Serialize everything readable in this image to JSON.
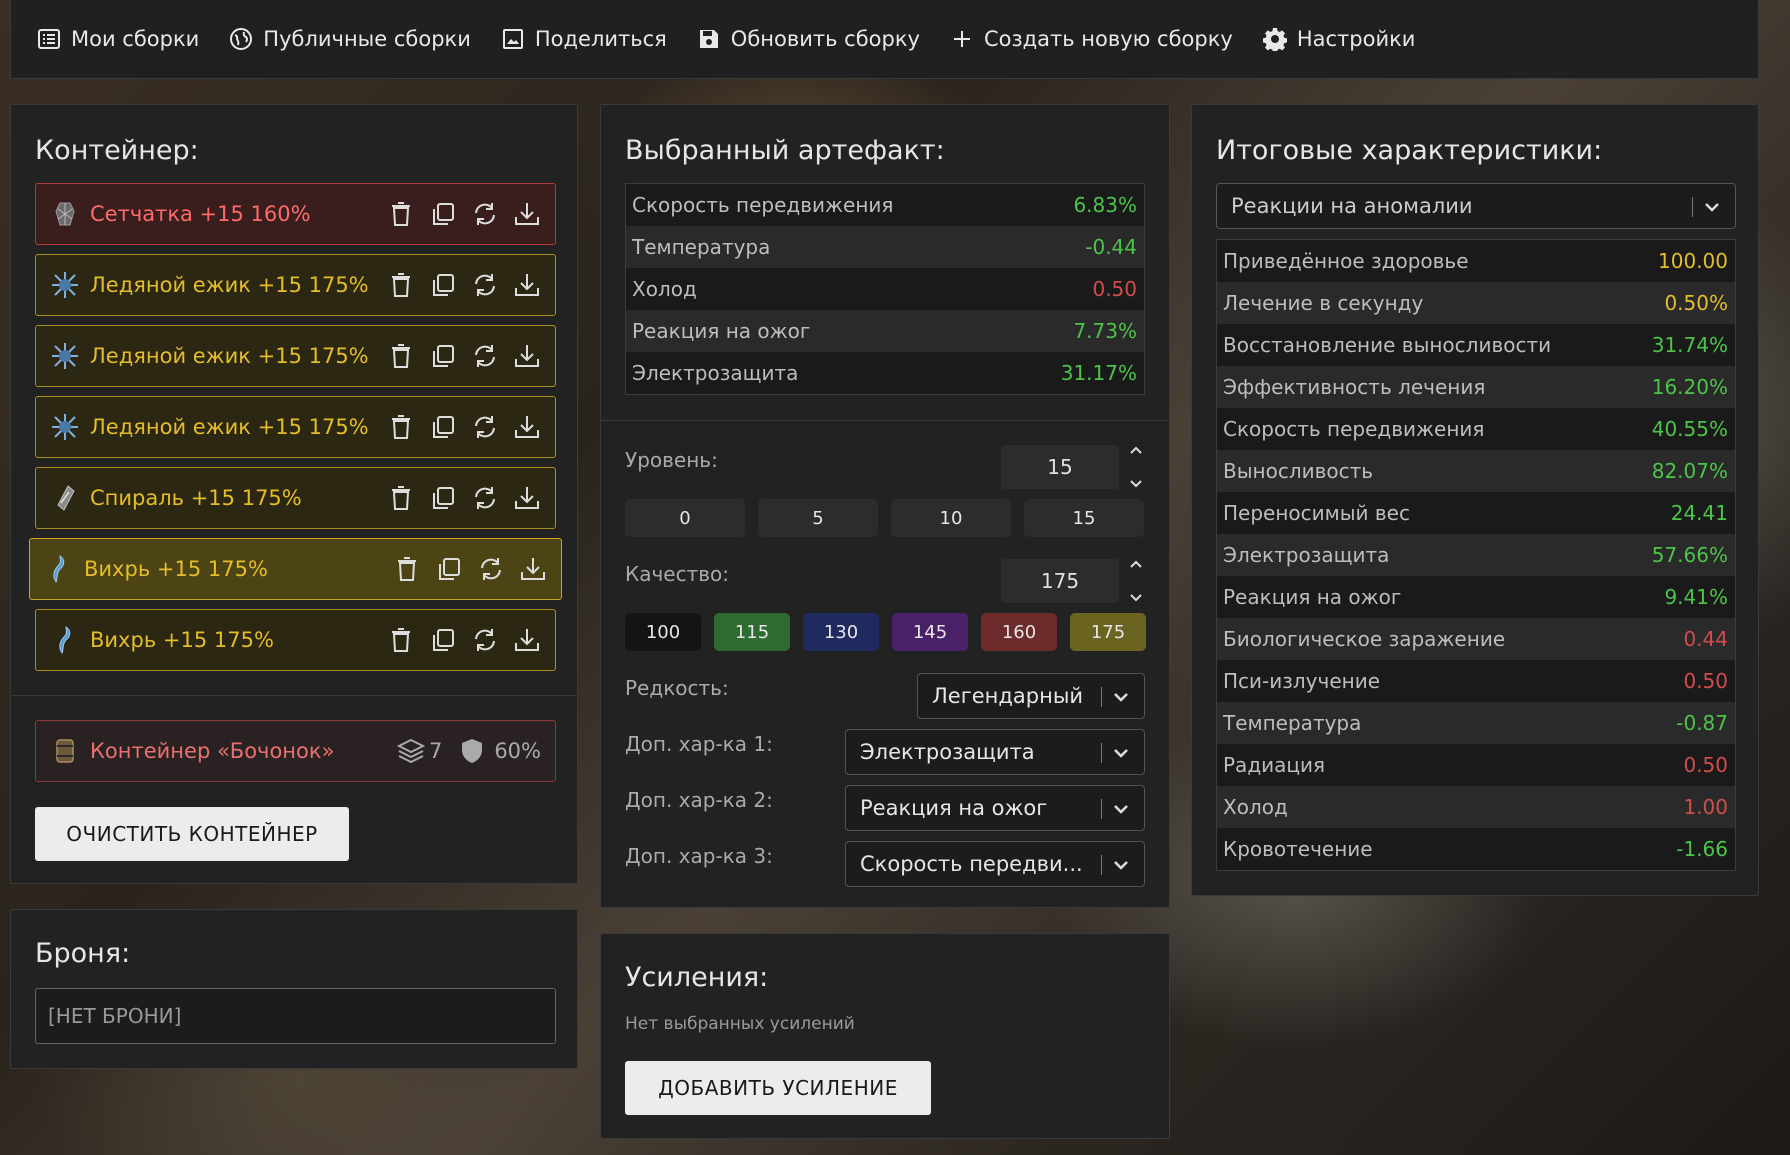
{
  "nav": {
    "my_builds": "Мои сборки",
    "public_builds": "Публичные сборки",
    "share": "Поделиться",
    "update_build": "Обновить сборку",
    "create_build": "Создать новую сборку",
    "settings": "Настройки"
  },
  "container": {
    "title": "Контейнер:",
    "items": [
      {
        "label": "Сетчатка +15 160%",
        "icon": "net-artifact-icon",
        "style": "red"
      },
      {
        "label": "Ледяной ежик +15 175%",
        "icon": "ice-hedgehog-icon",
        "style": "gold"
      },
      {
        "label": "Ледяной ежик +15 175%",
        "icon": "ice-hedgehog-icon",
        "style": "gold"
      },
      {
        "label": "Ледяной ежик +15 175%",
        "icon": "ice-hedgehog-icon",
        "style": "gold"
      },
      {
        "label": "Спираль +15 175%",
        "icon": "spiral-icon",
        "style": "gold"
      },
      {
        "label": "Вихрь +15 175%",
        "icon": "whirl-icon",
        "style": "gold-selected"
      },
      {
        "label": "Вихрь +15 175%",
        "icon": "whirl-icon",
        "style": "gold"
      }
    ],
    "barrel": {
      "label": "Контейнер «Бочонок»",
      "slots": "7",
      "protection": "60%"
    },
    "clear_button": "ОЧИСТИТЬ КОНТЕЙНЕР"
  },
  "armor": {
    "title": "Броня:",
    "placeholder": "[НЕТ БРОНИ]"
  },
  "selected": {
    "title": "Выбранный артефакт:",
    "stats": [
      {
        "name": "Скорость передвижения",
        "value": "6.83%",
        "color": "green"
      },
      {
        "name": "Температура",
        "value": "-0.44",
        "color": "green"
      },
      {
        "name": "Холод",
        "value": "0.50",
        "color": "red"
      },
      {
        "name": "Реакция на ожог",
        "value": "7.73%",
        "color": "green"
      },
      {
        "name": "Электрозащита",
        "value": "31.17%",
        "color": "green"
      }
    ],
    "level_label": "Уровень:",
    "level_value": "15",
    "level_presets": [
      "0",
      "5",
      "10",
      "15"
    ],
    "quality_label": "Качество:",
    "quality_value": "175",
    "quality_presets": [
      {
        "label": "100",
        "color": "#141414"
      },
      {
        "label": "115",
        "color": "#2f6a30"
      },
      {
        "label": "130",
        "color": "#1f2a5e"
      },
      {
        "label": "145",
        "color": "#4a2068"
      },
      {
        "label": "160",
        "color": "#6e2b2b"
      },
      {
        "label": "175",
        "color": "#6b6420"
      }
    ],
    "rarity_label": "Редкость:",
    "rarity_value": "Легендарный",
    "extra1_label": "Доп. хар-ка 1:",
    "extra1_value": "Электрозащита",
    "extra2_label": "Доп. хар-ка 2:",
    "extra2_value": "Реакция на ожог",
    "extra3_label": "Доп. хар-ка 3:",
    "extra3_value": "Скорость передви..."
  },
  "boosts": {
    "title": "Усиления:",
    "empty": "Нет выбранных усилений",
    "add_button": "ДОБАВИТЬ УСИЛЕНИЕ"
  },
  "totals": {
    "title": "Итоговые характеристики:",
    "filter": "Реакции на аномалии",
    "stats": [
      {
        "name": "Приведённое здоровье",
        "value": "100.00",
        "color": "yellow"
      },
      {
        "name": "Лечение в секунду",
        "value": "0.50%",
        "color": "yellow"
      },
      {
        "name": "Восстановление выносливости",
        "value": "31.74%",
        "color": "green"
      },
      {
        "name": "Эффективность лечения",
        "value": "16.20%",
        "color": "green"
      },
      {
        "name": "Скорость передвижения",
        "value": "40.55%",
        "color": "green"
      },
      {
        "name": "Выносливость",
        "value": "82.07%",
        "color": "green"
      },
      {
        "name": "Переносимый вес",
        "value": "24.41",
        "color": "green"
      },
      {
        "name": "Электрозащита",
        "value": "57.66%",
        "color": "green"
      },
      {
        "name": "Реакция на ожог",
        "value": "9.41%",
        "color": "green"
      },
      {
        "name": "Биологическое заражение",
        "value": "0.44",
        "color": "red"
      },
      {
        "name": "Пси-излучение",
        "value": "0.50",
        "color": "red"
      },
      {
        "name": "Температура",
        "value": "-0.87",
        "color": "green"
      },
      {
        "name": "Радиация",
        "value": "0.50",
        "color": "red"
      },
      {
        "name": "Холод",
        "value": "1.00",
        "color": "red"
      },
      {
        "name": "Кровотечение",
        "value": "-1.66",
        "color": "green"
      }
    ]
  }
}
